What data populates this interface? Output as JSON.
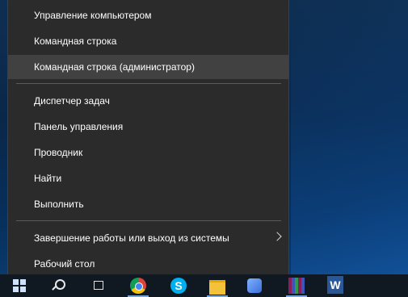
{
  "menu": {
    "items": [
      {
        "label": "Управление компьютером"
      },
      {
        "label": "Командная строка"
      },
      {
        "label": "Командная строка (администратор)"
      },
      {
        "label": "Диспетчер задач"
      },
      {
        "label": "Панель управления"
      },
      {
        "label": "Проводник"
      },
      {
        "label": "Найти"
      },
      {
        "label": "Выполнить"
      },
      {
        "label": "Завершение работы или выход из системы"
      },
      {
        "label": "Рабочий стол"
      }
    ],
    "hovered_item": "Командная строка (администратор)"
  },
  "colors": {
    "menu_bg": "#2b2b2b",
    "menu_hover": "#414141",
    "taskbar_bg": "#101822",
    "text": "#ffffff"
  },
  "taskbar": {
    "icons": [
      "windows-start-icon",
      "search-icon",
      "task-view-icon",
      "chrome-icon",
      "skype-icon",
      "file-explorer-icon",
      "paint-icon",
      "winrar-icon",
      "word-icon"
    ],
    "skype_glyph": "S",
    "word_glyph": "W"
  }
}
